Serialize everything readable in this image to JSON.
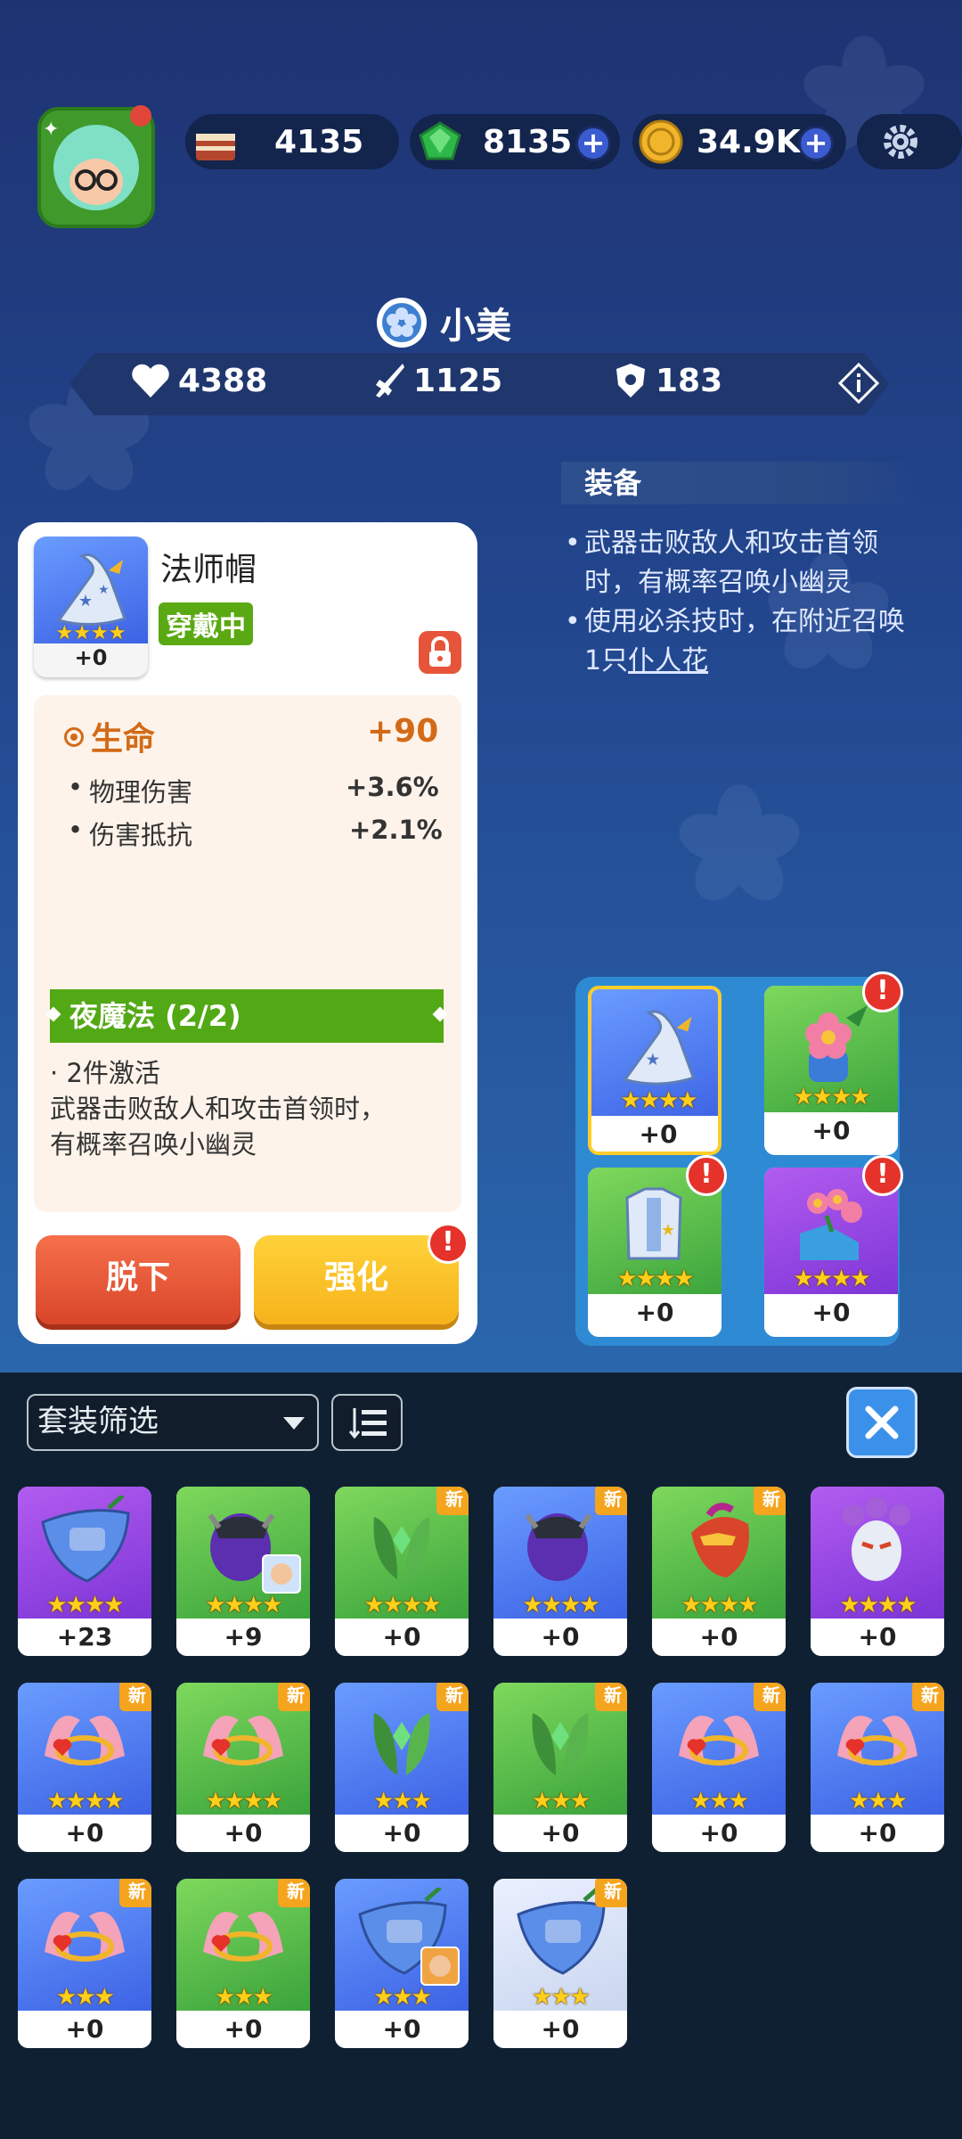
{
  "currency": {
    "cake": "4135",
    "gems": "8135",
    "coins": "34.9K"
  },
  "hero": {
    "name": "小美",
    "hp": "4388",
    "attack": "1125",
    "defense": "183"
  },
  "equip_panel": {
    "title": "装备",
    "line1": "武器击败敌人和攻击首领时，有概率召唤小幽灵",
    "line2_a": "使用必杀技时，在附近召唤1只",
    "line2_link": "仆人花"
  },
  "detail": {
    "item_name": "法师帽",
    "level": "+0",
    "status": "穿戴中",
    "main_stat": "生命",
    "main_value": "+90",
    "stats": [
      {
        "label": "物理伤害",
        "value": "+3.6%"
      },
      {
        "label": "伤害抵抗",
        "value": "+2.1%"
      }
    ],
    "set_name": "夜魔法 (2/2)",
    "set_count": "2件激活",
    "set_desc1": "武器击败敌人和攻击首领时，",
    "set_desc2": "有概率召唤小幽灵",
    "btn_unequip": "脱下",
    "btn_upgrade": "强化"
  },
  "slots": [
    {
      "level": "+0"
    },
    {
      "level": "+0"
    },
    {
      "level": "+0"
    },
    {
      "level": "+0"
    }
  ],
  "inventory": {
    "filter_label": "套装筛选",
    "new_badge": "新",
    "items": [
      {
        "level": "+23",
        "stars": "★★★★"
      },
      {
        "level": "+9",
        "stars": "★★★★"
      },
      {
        "level": "+0",
        "stars": "★★★★"
      },
      {
        "level": "+0",
        "stars": "★★★★"
      },
      {
        "level": "+0",
        "stars": "★★★★"
      },
      {
        "level": "+0",
        "stars": "★★★★"
      },
      {
        "level": "+0",
        "stars": "★★★★"
      },
      {
        "level": "+0",
        "stars": "★★★★"
      },
      {
        "level": "+0",
        "stars": "★★★"
      },
      {
        "level": "+0",
        "stars": "★★★"
      },
      {
        "level": "+0",
        "stars": "★★★"
      },
      {
        "level": "+0",
        "stars": "★★★"
      },
      {
        "level": "+0",
        "stars": "★★★"
      },
      {
        "level": "+0",
        "stars": "★★★"
      },
      {
        "level": "+0",
        "stars": "★★★"
      },
      {
        "level": "+0",
        "stars": "★★★"
      }
    ]
  },
  "colors": {
    "accent_green": "#52a915",
    "unequip_red": "#e0502f",
    "upgrade_yellow": "#f9c126",
    "alert_red": "#e5322a"
  }
}
